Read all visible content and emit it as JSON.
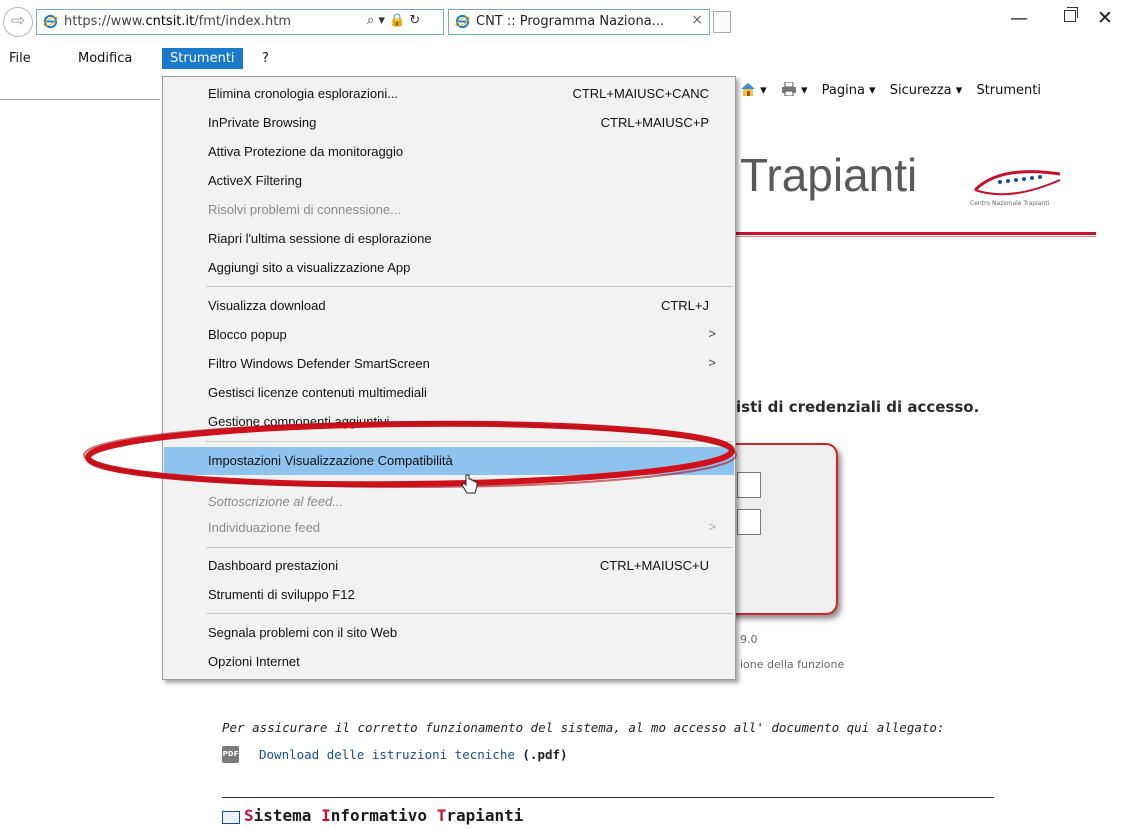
{
  "browser": {
    "url_prefix": "https://www.",
    "url_domain": "cntsit.it",
    "url_path": "/fmt/index.htm",
    "address_tools": "⌕ ▾ 🔒 ↻",
    "tab_title": "CNT :: Programma Naziona...",
    "tab_close": "×",
    "minimize": "—",
    "close": "✕"
  },
  "menubar": {
    "items": [
      {
        "label": "File"
      },
      {
        "label": "Modifica"
      },
      {
        "label": "Strumenti"
      },
      {
        "label": "?"
      }
    ]
  },
  "commandbar": {
    "home_arrow": "▾",
    "print_arrow": "▾",
    "pagina": "Pagina ▾",
    "sicurezza": "Sicurezza ▾",
    "strumenti": "Strumenti"
  },
  "page": {
    "logo_title": "Trapianti",
    "logo_sub": "Centro Nazionale Trapianti",
    "cred_text": "isti di credenziali di accesso.",
    "version": "9.0",
    "function_text": "ione della funzione",
    "notice": "Per assicurare il corretto funzionamento del sistema, al mo accesso all' documento qui allegato:",
    "pdf_icon": "PDF",
    "download_link": "Download delle istruzioni tecniche",
    "download_suffix": " (.pdf)",
    "sit_parts": [
      "S",
      "istema ",
      "I",
      "nformativo ",
      "T",
      "rapianti"
    ]
  },
  "menu": {
    "items": [
      {
        "label": "Elimina cronologia esplorazioni...",
        "shortcut": "CTRL+MAIUSC+CANC"
      },
      {
        "label": "InPrivate Browsing",
        "shortcut": "CTRL+MAIUSC+P"
      },
      {
        "label": "Attiva Protezione da monitoraggio",
        "shortcut": ""
      },
      {
        "label": "ActiveX Filtering",
        "shortcut": ""
      },
      {
        "label": "Risolvi problemi di connessione...",
        "shortcut": "",
        "disabled": true
      },
      {
        "label": "Riapri l'ultima sessione di esplorazione",
        "shortcut": ""
      },
      {
        "label": "Aggiungi sito a visualizzazione App",
        "shortcut": ""
      },
      {
        "label": "Visualizza download",
        "shortcut": "CTRL+J"
      },
      {
        "label": "Blocco popup",
        "shortcut": "",
        "submenu": true
      },
      {
        "label": "Filtro Windows Defender SmartScreen",
        "shortcut": "",
        "submenu": true
      },
      {
        "label": "Gestisci licenze contenuti multimediali",
        "shortcut": ""
      },
      {
        "label": "Gestione componenti aggiuntivi",
        "shortcut": ""
      },
      {
        "label": "Impostazioni Visualizzazione Compatibilità",
        "shortcut": "",
        "highlighted": true
      },
      {
        "label": "Sottoscrizione al feed...",
        "shortcut": "",
        "disabled": true
      },
      {
        "label": "Individuazione feed",
        "shortcut": "",
        "disabled": true,
        "submenu": true
      },
      {
        "label": "Dashboard prestazioni",
        "shortcut": "CTRL+MAIUSC+U"
      },
      {
        "label": "Strumenti di sviluppo F12",
        "shortcut": ""
      },
      {
        "label": "Segnala problemi con il sito Web",
        "shortcut": ""
      },
      {
        "label": "Opzioni Internet",
        "shortcut": ""
      }
    ],
    "submenu_arrow": ">"
  },
  "colors": {
    "menu_highlight": "#8ec3ef",
    "active_menubar": "#1979ca",
    "annotation_red": "#d0111b"
  }
}
